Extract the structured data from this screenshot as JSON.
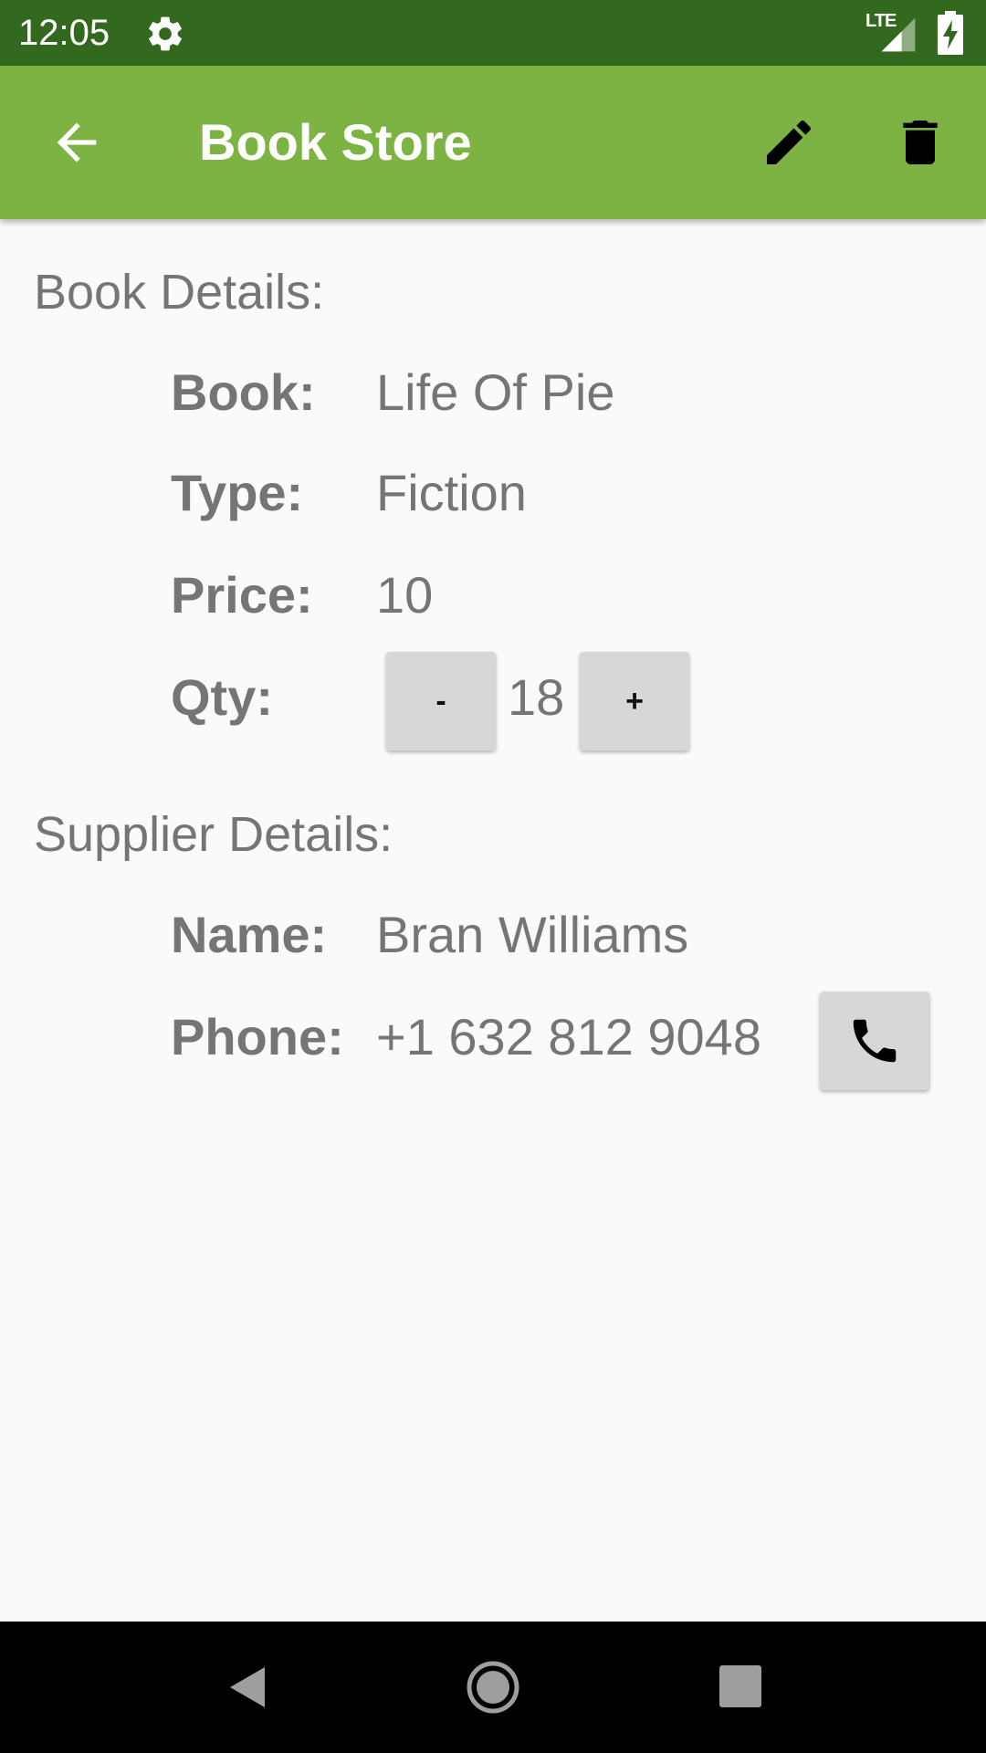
{
  "status_bar": {
    "time": "12:05",
    "network": "LTE",
    "icons": [
      "settings-gear-icon",
      "lte-signal-icon",
      "battery-charging-icon"
    ]
  },
  "app_bar": {
    "title": "Book Store",
    "background_color": "#7cb342",
    "icons": [
      "arrow-back-icon",
      "pencil-edit-icon",
      "trash-delete-icon"
    ]
  },
  "book_details": {
    "heading": "Book Details:",
    "book_label": "Book:",
    "book_value": "Life Of Pie",
    "type_label": "Type:",
    "type_value": "Fiction",
    "price_label": "Price:",
    "price_value": "10",
    "qty_label": "Qty:",
    "qty_value": "18",
    "decrement_label": "-",
    "increment_label": "+"
  },
  "supplier_details": {
    "heading": "Supplier Details:",
    "name_label": "Name:",
    "name_value": "Bran Williams",
    "phone_label": "Phone:",
    "phone_value": "+1 632 812 9048",
    "call_icon": "phone-icon"
  },
  "nav_bar": {
    "icons": [
      "nav-back-icon",
      "nav-home-icon",
      "nav-recents-icon"
    ]
  },
  "colors": {
    "status_bar": "#33691e",
    "app_bar": "#7cb342",
    "text_secondary": "#757575",
    "button_bg": "#d6d7d7"
  }
}
